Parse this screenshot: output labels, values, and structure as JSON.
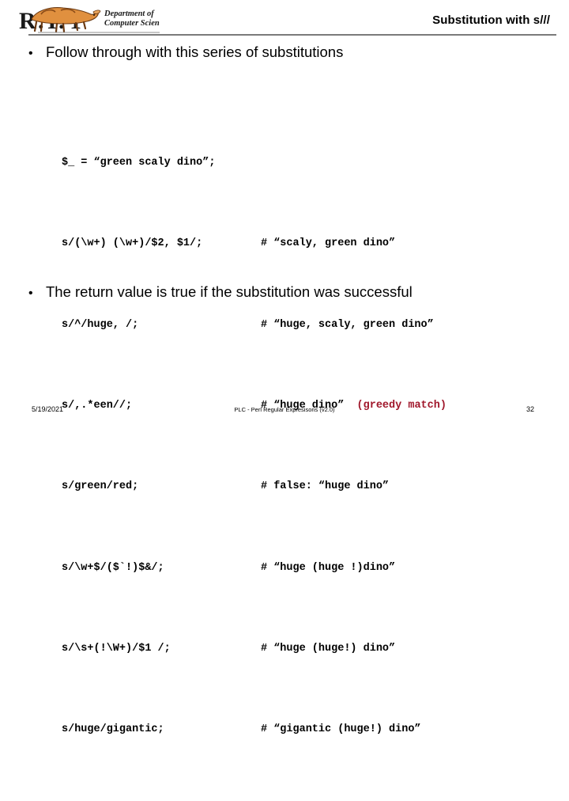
{
  "header": {
    "title": "Substitution with s///",
    "logo": {
      "name": "rit-cs-logo",
      "letters": "R.I.T",
      "dept_line_1": "Department of",
      "dept_line_2": "Computer Science",
      "tiger_color": "#d9843b"
    }
  },
  "bullets": [
    {
      "marker": "•",
      "text": "Follow through with this series of substitutions"
    },
    {
      "marker": "•",
      "text": "The return value is true if the substitution was successful"
    }
  ],
  "code": {
    "note_color": "#a0172b",
    "lines": [
      {
        "stmt": "$_ = “green scaly dino”;",
        "comment": "",
        "note": ""
      },
      {
        "stmt": "s/(\\w+) (\\w+)/$2, $1/;",
        "comment": "# “scaly, green dino”",
        "note": ""
      },
      {
        "stmt": "s/^/huge, /;",
        "comment": "# “huge, scaly, green dino”",
        "note": ""
      },
      {
        "stmt": "s/,.*een//;",
        "comment": "# “huge dino”",
        "note": "  (greedy match)"
      },
      {
        "stmt": "s/green/red;",
        "comment": "# false: “huge dino”",
        "note": ""
      },
      {
        "stmt": "s/\\w+$/($`!)$&/;",
        "comment": "# “huge (huge !)dino”",
        "note": ""
      },
      {
        "stmt": "s/\\s+(!\\W+)/$1 /;",
        "comment": "# “huge (huge!) dino”",
        "note": ""
      },
      {
        "stmt": "s/huge/gigantic;",
        "comment": "# “gigantic (huge!) dino”",
        "note": ""
      }
    ]
  },
  "footer": {
    "date": "5/19/2021",
    "center": "PLC - Perl Regular Expresisons  (v2.0)",
    "page": "32"
  }
}
